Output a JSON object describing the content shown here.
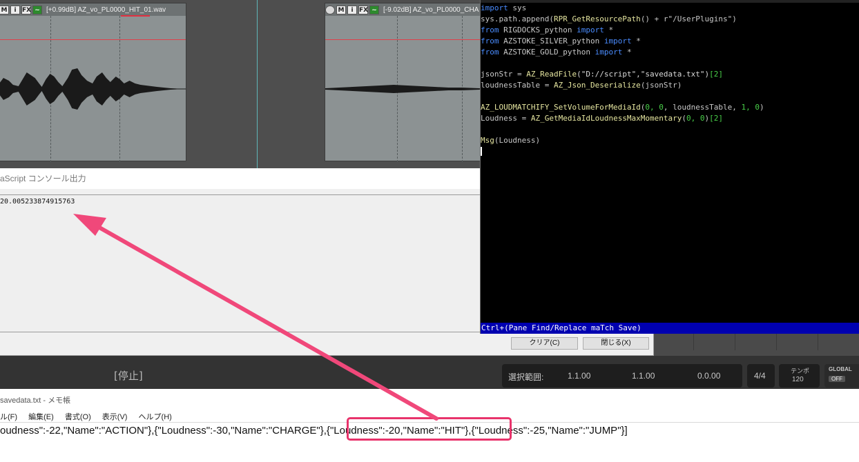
{
  "arrange": {
    "item1": {
      "m_label": "M",
      "i_label": "i",
      "fx_label": "FX",
      "title": "[+0.99dB] AZ_vo_PL0000_HIT_01.wav"
    },
    "item2": {
      "m_label": "M",
      "i_label": "i",
      "fx_label": "FX",
      "title": "[-9.02dB] AZ_vo_PL0000_CHA"
    },
    "colors": {
      "volume_line": "#e0404a",
      "edit_cursor": "#5fb7b9"
    }
  },
  "console": {
    "title": "aScript コンソール出力",
    "output": "20.005233874915763",
    "clear_button": "クリア(C)",
    "close_button": "閉じる(X)"
  },
  "editor": {
    "lines": [
      [
        {
          "t": "import",
          "c": "kw"
        },
        {
          "t": " sys",
          "c": "plain"
        }
      ],
      [
        {
          "t": "sys.path.append(",
          "c": "plain"
        },
        {
          "t": "RPR_GetResourcePath",
          "c": "fn"
        },
        {
          "t": "() + r\"/UserPlugins\")",
          "c": "plain"
        }
      ],
      [
        {
          "t": "from",
          "c": "kw"
        },
        {
          "t": " RIGDOCKS_python ",
          "c": "plain"
        },
        {
          "t": "import",
          "c": "kw"
        },
        {
          "t": " *",
          "c": "plain"
        }
      ],
      [
        {
          "t": "from",
          "c": "kw"
        },
        {
          "t": " AZSTOKE_SILVER_python ",
          "c": "plain"
        },
        {
          "t": "import",
          "c": "kw"
        },
        {
          "t": " *",
          "c": "plain"
        }
      ],
      [
        {
          "t": "from",
          "c": "kw"
        },
        {
          "t": " AZSTOKE_GOLD_python ",
          "c": "plain"
        },
        {
          "t": "import",
          "c": "kw"
        },
        {
          "t": " *",
          "c": "plain"
        }
      ],
      [],
      [
        {
          "t": "jsonStr = ",
          "c": "plain"
        },
        {
          "t": "AZ_ReadFile",
          "c": "fn"
        },
        {
          "t": "(\"D://script\",\"savedata.txt\")",
          "c": "str"
        },
        {
          "t": "[2]",
          "c": "num"
        }
      ],
      [
        {
          "t": "loudnessTable = ",
          "c": "plain"
        },
        {
          "t": "AZ_Json_Deserialize",
          "c": "fn"
        },
        {
          "t": "(jsonStr)",
          "c": "plain"
        }
      ],
      [],
      [
        {
          "t": "AZ_LOUDMATCHIFY_SetVolumeForMediaId",
          "c": "fn"
        },
        {
          "t": "(",
          "c": "plain"
        },
        {
          "t": "0, 0",
          "c": "num"
        },
        {
          "t": ", loudnessTable, ",
          "c": "plain"
        },
        {
          "t": "1, 0",
          "c": "num"
        },
        {
          "t": ")",
          "c": "plain"
        }
      ],
      [
        {
          "t": "Loudness = ",
          "c": "plain"
        },
        {
          "t": "AZ_GetMediaIdLoudnessMaxMomentary",
          "c": "fn"
        },
        {
          "t": "(",
          "c": "plain"
        },
        {
          "t": "0, 0",
          "c": "num"
        },
        {
          "t": ")",
          "c": "plain"
        },
        {
          "t": "[2]",
          "c": "num"
        }
      ],
      [],
      [
        {
          "t": "Msg",
          "c": "fn"
        },
        {
          "t": "(Loudness)",
          "c": "plain"
        }
      ]
    ],
    "status": "Ctrl+(Pane Find/Replace maTch Save)"
  },
  "transport": {
    "state": "[停止]",
    "selection_label": "選択範囲:",
    "sel_start": "1.1.00",
    "sel_end": "1.1.00",
    "sel_length": "0.0.00",
    "time_sig": "4/4",
    "tempo_label": "テンポ",
    "tempo_value": "120",
    "global_label": "GLOBAL",
    "global_state": "OFF"
  },
  "notepad": {
    "title": "savedata.txt - メモ帳",
    "menu": [
      "ル(F)",
      "編集(E)",
      "書式(O)",
      "表示(V)",
      "ヘルプ(H)"
    ],
    "text": "oudness\":-22,\"Name\":\"ACTION\"},{\"Loudness\":-30,\"Name\":\"CHARGE\"},{\"Loudness\":-20,\"Name\":\"HIT\"},{\"Loudness\":-25,\"Name\":\"JUMP\"}]"
  },
  "annotation": {
    "color": "#f0487a"
  }
}
